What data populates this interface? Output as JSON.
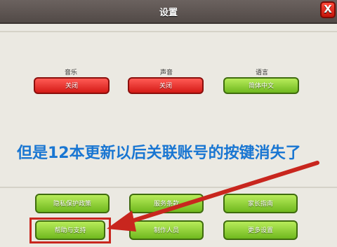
{
  "header": {
    "title": "设置",
    "close_label": "X"
  },
  "settings": [
    {
      "label": "音乐",
      "value": "关闭",
      "color": "#e0241f"
    },
    {
      "label": "声音",
      "value": "关闭",
      "color": "#e0241f"
    },
    {
      "label": "语言",
      "value": "简体中文",
      "color": "#8fd12e"
    }
  ],
  "annotation": {
    "text": "但是12本更新以后关联账号的按键消失了",
    "color": "#1976d2"
  },
  "bottom_buttons": [
    {
      "label": "隐私保护政策"
    },
    {
      "label": "服务条款"
    },
    {
      "label": "家长指南"
    },
    {
      "label": "帮助与支持"
    },
    {
      "label": "制作人员"
    },
    {
      "label": "更多设置"
    }
  ]
}
